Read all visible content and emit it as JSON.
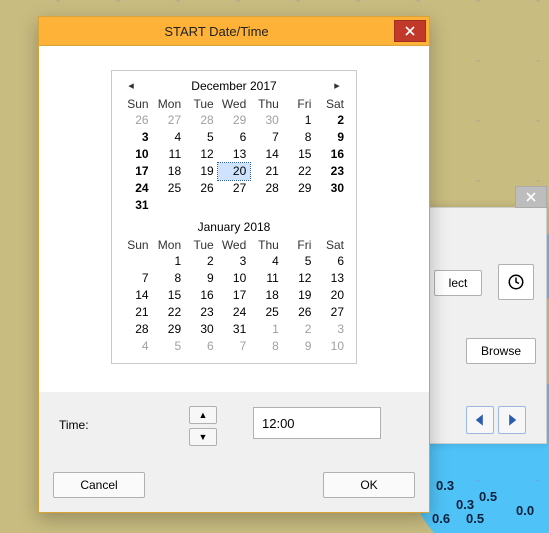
{
  "dialog": {
    "title": "START Date/Time",
    "time_label": "Time:",
    "time_value": "12:00",
    "cancel_label": "Cancel",
    "ok_label": "OK"
  },
  "calendar": {
    "dow": [
      "Sun",
      "Mon",
      "Tue",
      "Wed",
      "Thu",
      "Fri",
      "Sat"
    ],
    "months": [
      {
        "title": "December 2017",
        "show_prev": true,
        "show_next": true,
        "weeks": [
          [
            {
              "n": 26,
              "out": true
            },
            {
              "n": 27,
              "out": true
            },
            {
              "n": 28,
              "out": true
            },
            {
              "n": 29,
              "out": true
            },
            {
              "n": 30,
              "out": true
            },
            {
              "n": 1
            },
            {
              "n": 2,
              "bold": true
            }
          ],
          [
            {
              "n": 3,
              "bold": true
            },
            {
              "n": 4
            },
            {
              "n": 5
            },
            {
              "n": 6
            },
            {
              "n": 7
            },
            {
              "n": 8
            },
            {
              "n": 9,
              "bold": true
            }
          ],
          [
            {
              "n": 10,
              "bold": true
            },
            {
              "n": 11
            },
            {
              "n": 12
            },
            {
              "n": 13
            },
            {
              "n": 14
            },
            {
              "n": 15
            },
            {
              "n": 16,
              "bold": true
            }
          ],
          [
            {
              "n": 17,
              "bold": true
            },
            {
              "n": 18
            },
            {
              "n": 19
            },
            {
              "n": 20,
              "selected": true
            },
            {
              "n": 21
            },
            {
              "n": 22
            },
            {
              "n": 23,
              "bold": true
            }
          ],
          [
            {
              "n": 24,
              "bold": true
            },
            {
              "n": 25
            },
            {
              "n": 26
            },
            {
              "n": 27
            },
            {
              "n": 28
            },
            {
              "n": 29
            },
            {
              "n": 30,
              "bold": true
            }
          ],
          [
            {
              "n": 31,
              "bold": true
            },
            {
              "blank": true
            },
            {
              "blank": true
            },
            {
              "blank": true
            },
            {
              "blank": true
            },
            {
              "blank": true
            },
            {
              "blank": true
            }
          ]
        ]
      },
      {
        "title": "January 2018",
        "show_prev": false,
        "show_next": false,
        "weeks": [
          [
            {
              "blank": true
            },
            {
              "n": 1
            },
            {
              "n": 2
            },
            {
              "n": 3
            },
            {
              "n": 4
            },
            {
              "n": 5
            },
            {
              "n": 6
            }
          ],
          [
            {
              "n": 7
            },
            {
              "n": 8
            },
            {
              "n": 9
            },
            {
              "n": 10
            },
            {
              "n": 11
            },
            {
              "n": 12
            },
            {
              "n": 13
            }
          ],
          [
            {
              "n": 14
            },
            {
              "n": 15
            },
            {
              "n": 16
            },
            {
              "n": 17
            },
            {
              "n": 18
            },
            {
              "n": 19
            },
            {
              "n": 20
            }
          ],
          [
            {
              "n": 21
            },
            {
              "n": 22
            },
            {
              "n": 23
            },
            {
              "n": 24
            },
            {
              "n": 25
            },
            {
              "n": 26
            },
            {
              "n": 27
            }
          ],
          [
            {
              "n": 28
            },
            {
              "n": 29
            },
            {
              "n": 30
            },
            {
              "n": 31
            },
            {
              "n": 1,
              "out": true
            },
            {
              "n": 2,
              "out": true
            },
            {
              "n": 3,
              "out": true
            }
          ],
          [
            {
              "n": 4,
              "out": true
            },
            {
              "n": 5,
              "out": true
            },
            {
              "n": 6,
              "out": true
            },
            {
              "n": 7,
              "out": true
            },
            {
              "n": 8,
              "out": true
            },
            {
              "n": 9,
              "out": true
            },
            {
              "n": 10,
              "out": true
            }
          ]
        ]
      }
    ]
  },
  "aux": {
    "select_label": "lect",
    "browse_label": "Browse"
  },
  "map_labels": {
    "a": "0.3",
    "b": "0.6",
    "c": "0.5",
    "d": "0.5",
    "e": "0.0",
    "f": "0.3"
  }
}
